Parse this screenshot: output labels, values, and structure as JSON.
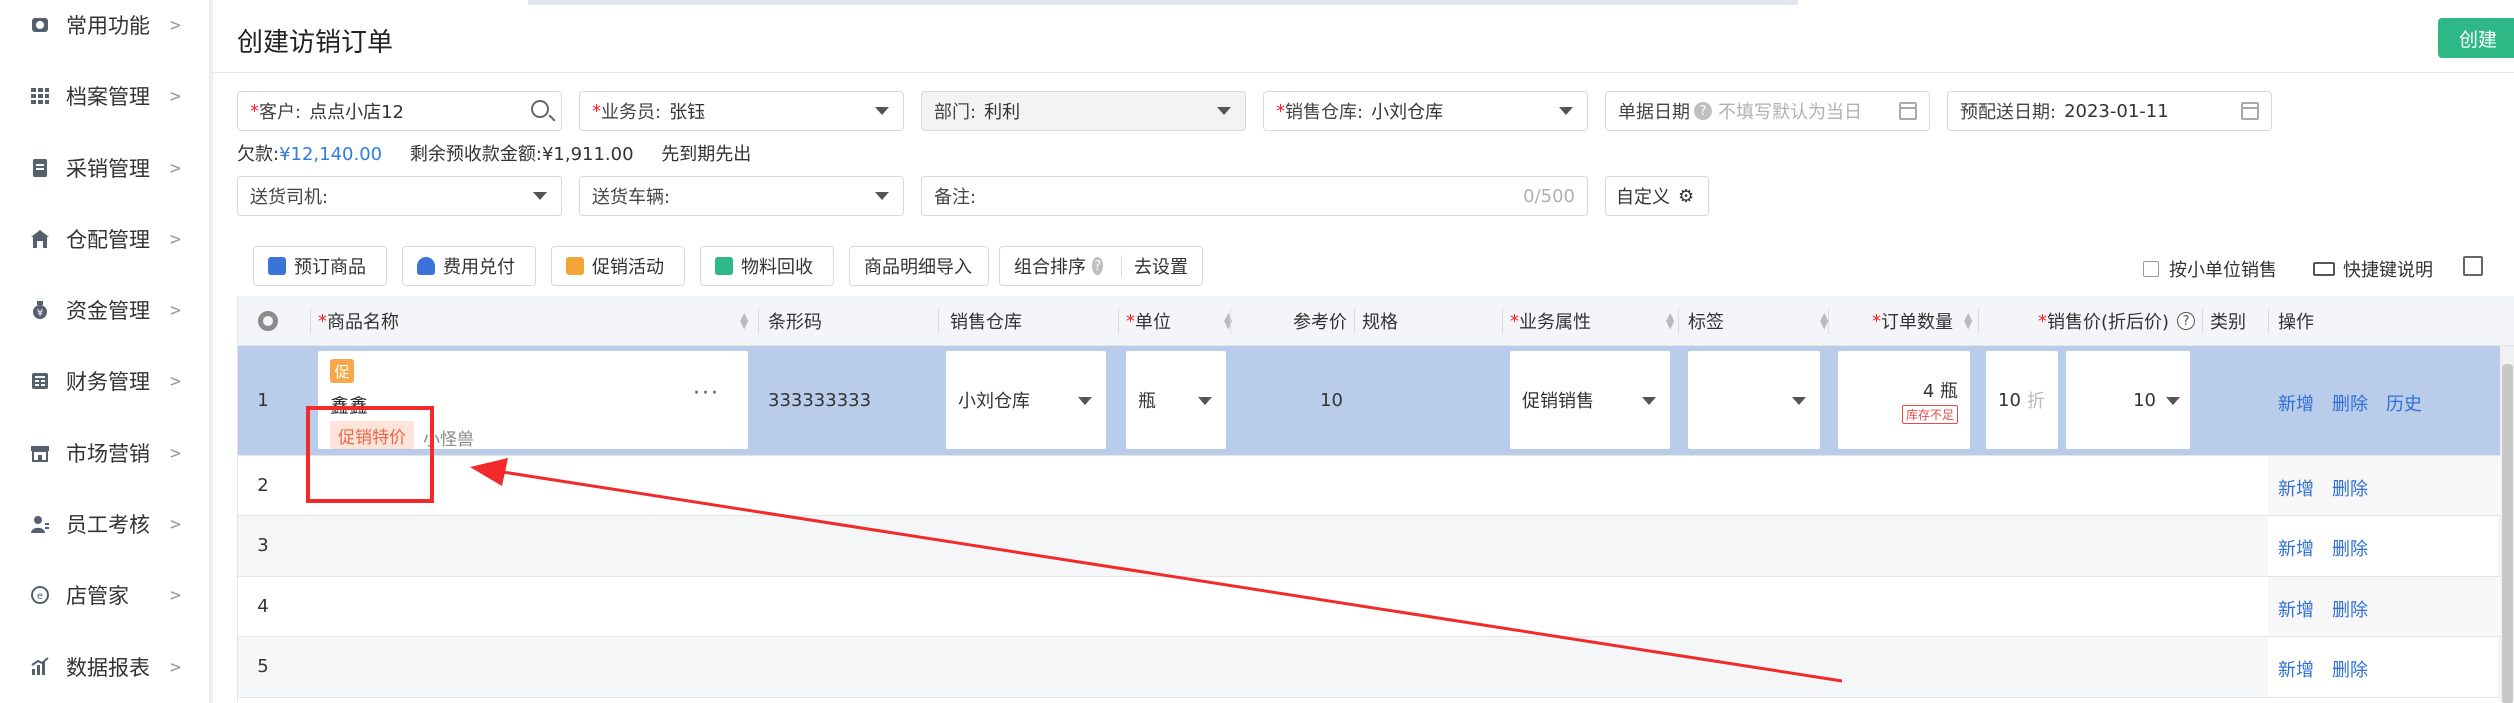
{
  "sidebar": {
    "items": [
      {
        "label": "常用功能",
        "icon": "camera-icon"
      },
      {
        "label": "档案管理",
        "icon": "grid-icon"
      },
      {
        "label": "采销管理",
        "icon": "document-icon"
      },
      {
        "label": "仓配管理",
        "icon": "warehouse-icon"
      },
      {
        "label": "资金管理",
        "icon": "money-bag-icon"
      },
      {
        "label": "财务管理",
        "icon": "ledger-icon"
      },
      {
        "label": "市场营销",
        "icon": "store-icon"
      },
      {
        "label": "员工考核",
        "icon": "user-icon"
      },
      {
        "label": "店管家",
        "icon": "shop-keeper-icon"
      },
      {
        "label": "数据报表",
        "icon": "bar-chart-icon"
      }
    ]
  },
  "header": {
    "title": "创建访销订单",
    "create_label": "创建"
  },
  "form": {
    "customer": {
      "label": "客户:",
      "value": "点点小店12"
    },
    "salesman": {
      "label": "业务员:",
      "value": "张钰"
    },
    "department": {
      "label": "部门:",
      "value": "利利"
    },
    "warehouse": {
      "label": "销售仓库:",
      "value": "小刘仓库"
    },
    "doc_date": {
      "label": "单据日期",
      "placeholder": "不填写默认为当日"
    },
    "delivery_date": {
      "label": "预配送日期:",
      "value": "2023-01-11"
    },
    "driver": {
      "label": "送货司机:"
    },
    "vehicle": {
      "label": "送货车辆:"
    },
    "remark": {
      "label": "备注:",
      "counter": "0/500"
    },
    "custom_label": "自定义"
  },
  "info": {
    "debt_label": "欠款:",
    "debt_value": "¥12,140.00",
    "prepay_label": "剩余预收款金额:",
    "prepay_value": "¥1,911.00",
    "policy": "先到期先出"
  },
  "toolbar": {
    "preorder": "预订商品",
    "fee": "费用兑付",
    "promo": "促销活动",
    "recycle": "物料回收",
    "import": "商品明细导入",
    "combo_sort": "组合排序",
    "setup": "去设置",
    "small_unit": "按小单位销售",
    "shortcut": "快捷键说明"
  },
  "table": {
    "headers": {
      "name": "商品名称",
      "barcode": "条形码",
      "warehouse": "销售仓库",
      "unit": "单位",
      "ref_price": "参考价",
      "spec": "规格",
      "biz_attr": "业务属性",
      "tag": "标签",
      "qty": "订单数量",
      "price": "销售价(折后价)",
      "category": "类别",
      "ops": "操作"
    },
    "row1": {
      "index": "1",
      "promo_badge": "促",
      "name": "鑫鑫",
      "promo_tag": "促销特价",
      "promo_name": "小怪兽",
      "barcode": "333333333",
      "warehouse": "小刘仓库",
      "unit": "瓶",
      "ref_price": "10",
      "biz_attr": "促销销售",
      "qty": "4 瓶",
      "stock_warn": "库存不足",
      "discount": "10",
      "discount_unit": "折",
      "price": "10"
    },
    "row_indices": [
      "2",
      "3",
      "4",
      "5"
    ],
    "op_add": "新增",
    "op_delete": "删除",
    "op_history": "历史"
  },
  "colors": {
    "accent": "#2eb886",
    "link": "#2f6fd6",
    "selected_row": "#b9cdea",
    "annotation": "#f22a2a"
  }
}
